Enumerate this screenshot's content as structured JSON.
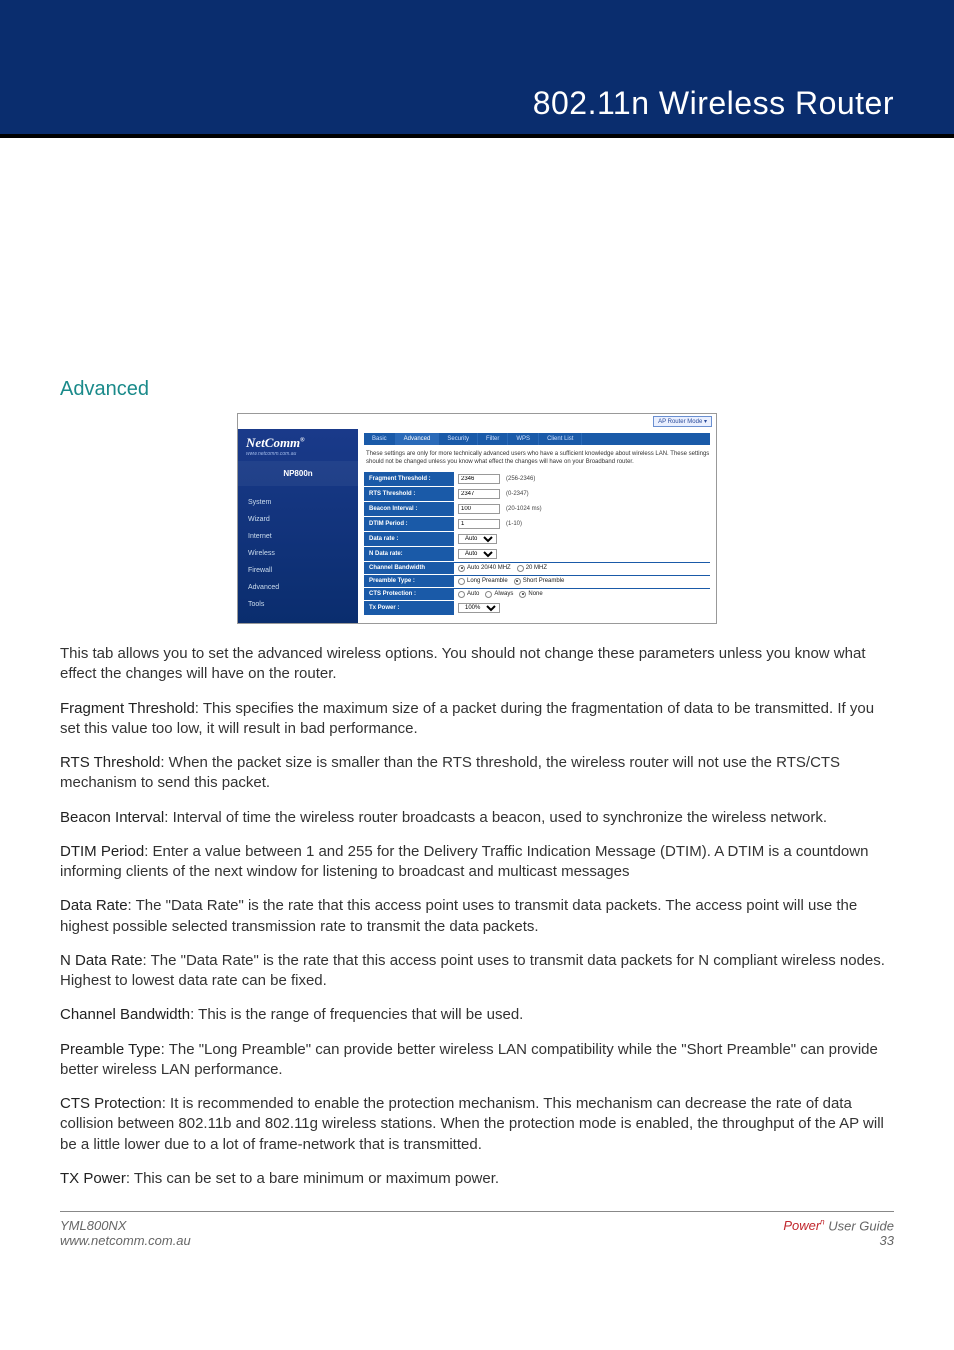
{
  "header": {
    "title": "802.11n Wireless Router"
  },
  "section": {
    "title": "Advanced"
  },
  "screenshot": {
    "mode_button": "AP Router Mode ▾",
    "logo": "NetComm",
    "logo_tm": "®",
    "url": "www.netcomm.com.au",
    "model": "NP800n",
    "nav": [
      "System",
      "Wizard",
      "Internet",
      "Wireless",
      "Firewall",
      "Advanced",
      "Tools"
    ],
    "tabs": [
      "Basic",
      "Advanced",
      "Security",
      "Filter",
      "WPS",
      "Client List"
    ],
    "active_tab": "Advanced",
    "note": "These settings are only for more technically advanced users who have a sufficient knowledge about wireless LAN. These settings should not be changed unless you know what effect the changes will have on your Broadband router.",
    "rows": {
      "fragment": {
        "label": "Fragment Threshold :",
        "value": "2346",
        "hint": "(256-2346)"
      },
      "rts": {
        "label": "RTS Threshold :",
        "value": "2347",
        "hint": "(0-2347)"
      },
      "beacon": {
        "label": "Beacon Interval :",
        "value": "100",
        "hint": "(20-1024 ms)"
      },
      "dtim": {
        "label": "DTIM Period :",
        "value": "1",
        "hint": "(1-10)"
      },
      "datarate": {
        "label": "Data rate :",
        "value": "Auto"
      },
      "ndatarate": {
        "label": "N Data rate:",
        "value": "Auto"
      },
      "bw": {
        "label": "Channel Bandwidth",
        "opt1": "Auto 20/40 MHZ",
        "opt2": "20 MHZ"
      },
      "preamble": {
        "label": "Preamble Type :",
        "opt1": "Long Preamble",
        "opt2": "Short Preamble"
      },
      "cts": {
        "label": "CTS Protection :",
        "opt1": "Auto",
        "opt2": "Always",
        "opt3": "None"
      },
      "tx": {
        "label": "Tx Power :",
        "value": "100%"
      }
    }
  },
  "body": {
    "intro": "This tab allows you to set the advanced wireless options. You should not change these parameters unless you know what effect the changes will have on the router.",
    "fragment_t": "Fragment Threshold",
    "fragment": ": This specifies the maximum size of a packet during the fragmentation of data to be transmitted. If you set this value too low, it will result in bad performance.",
    "rts_t": "RTS Threshold",
    "rts": ": When the packet size is smaller than the RTS threshold, the wireless router will not use the RTS/CTS mechanism to send this packet.",
    "beacon_t": "Beacon Interval",
    "beacon": ": Interval of time the wireless router broadcasts a beacon, used to synchronize the wireless network.",
    "dtim_t": "DTIM Period",
    "dtim": ": Enter a value between 1 and 255 for the Delivery Traffic Indication Message (DTIM). A DTIM is a countdown informing clients of the next window for listening to broadcast and multicast messages",
    "datarate_t": "Data Rate",
    "datarate": ": The \"Data Rate\" is the rate that this access point uses to transmit data packets. The access point will use the highest possible selected transmission rate to transmit the data packets.",
    "ndatarate_t": "N Data Rate",
    "ndatarate": ": The \"Data Rate\" is the rate that this access point uses to transmit data packets for N compliant wireless nodes. Highest to lowest data rate can be fixed.",
    "bw_t": "Channel Bandwidth",
    "bw": ":  This is the range of frequencies that will be used.",
    "preamble_t": "Preamble Type",
    "preamble": ": The \"Long Preamble\" can provide better wireless LAN compatibility while the \"Short Preamble\" can provide better wireless LAN performance.",
    "cts_t": "CTS Protection",
    "cts": ": It is recommended to enable the protection mechanism. This mechanism can decrease the rate of data collision between 802.11b and 802.11g wireless stations. When the protection mode is enabled, the throughput of the AP will be a little lower due to a lot of frame-network that is transmitted.",
    "tx_t": "TX Power",
    "tx": ": This can be set to a bare minimum or maximum power."
  },
  "footer": {
    "left1": "YML800NX",
    "left2": "www.netcomm.com.au",
    "brand": "Power",
    "brand_sup": "n",
    "guide": " User Guide",
    "page": "33"
  }
}
